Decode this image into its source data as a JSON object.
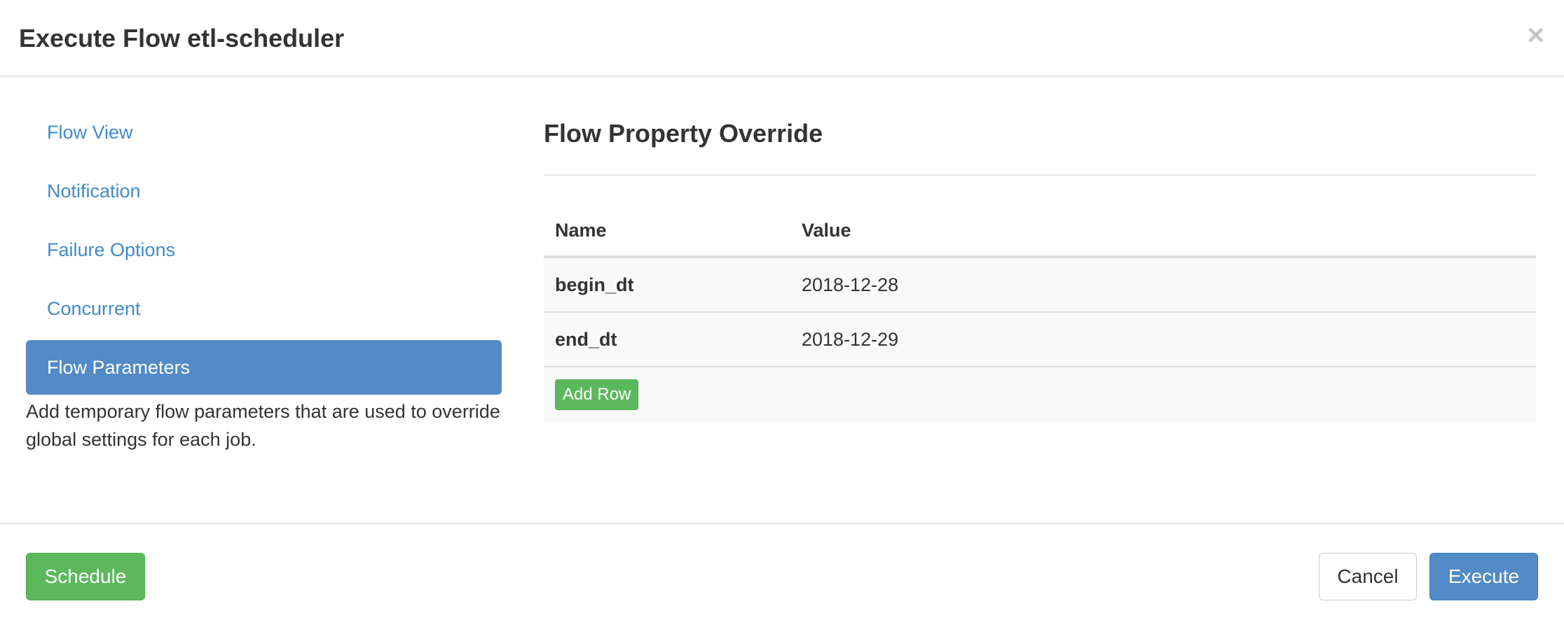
{
  "dialog": {
    "title": "Execute Flow etl-scheduler",
    "close_label": "×"
  },
  "nav": {
    "items": [
      {
        "label": "Flow View"
      },
      {
        "label": "Notification"
      },
      {
        "label": "Failure Options"
      },
      {
        "label": "Concurrent"
      },
      {
        "label": "Flow Parameters",
        "active": true
      }
    ],
    "description": "Add temporary flow parameters that are used to override global settings for each job."
  },
  "main": {
    "section_title": "Flow Property Override",
    "table": {
      "columns": [
        "Name",
        "Value"
      ],
      "rows": [
        {
          "name": "begin_dt",
          "value": "2018-12-28"
        },
        {
          "name": "end_dt",
          "value": "2018-12-29"
        }
      ],
      "add_row_label": "Add Row"
    }
  },
  "footer": {
    "schedule_label": "Schedule",
    "cancel_label": "Cancel",
    "execute_label": "Execute"
  },
  "colors": {
    "primary": "#528bc5",
    "success": "#5cb85c",
    "link": "#428bca"
  }
}
